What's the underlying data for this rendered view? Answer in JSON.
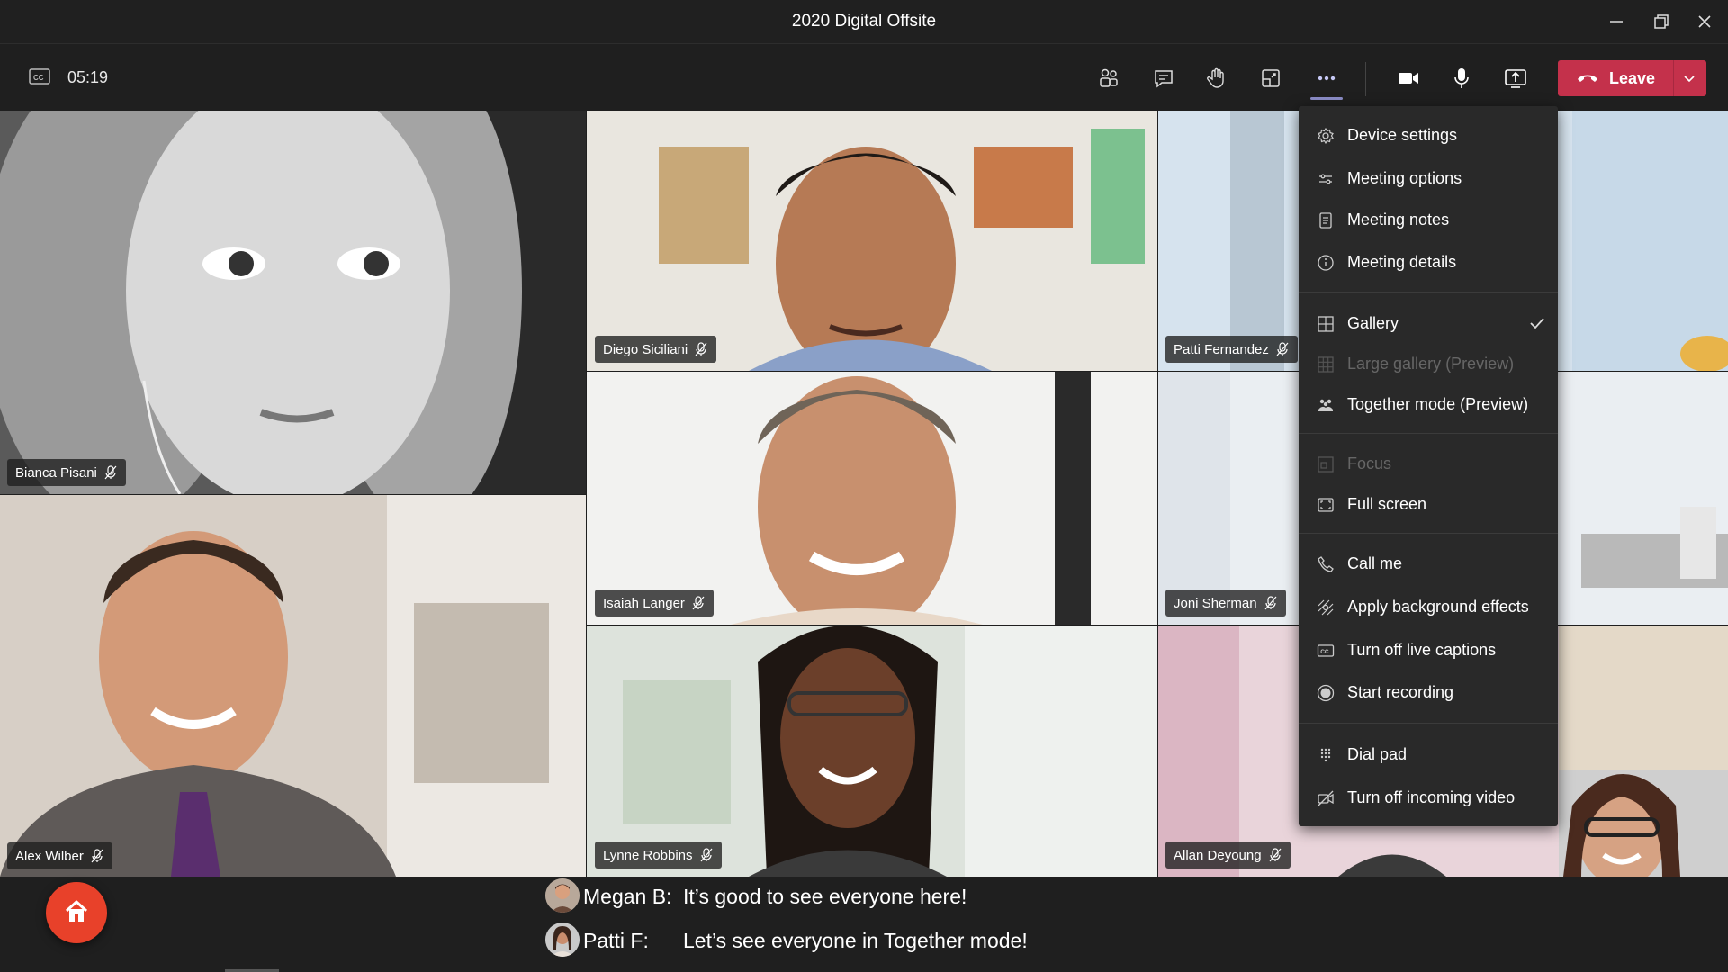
{
  "window": {
    "title": "2020 Digital Offsite"
  },
  "toolbar": {
    "timer": "05:19",
    "leave_label": "Leave",
    "icons": [
      "captions-icon",
      "people-icon",
      "chat-icon",
      "raise-hand-icon",
      "breakout-rooms-icon",
      "more-actions-icon",
      "camera-icon",
      "microphone-icon",
      "share-screen-icon",
      "hang-up-icon",
      "chevron-down-icon"
    ]
  },
  "participants": [
    {
      "name": "Bianca Pisani"
    },
    {
      "name": "Diego Siciliani"
    },
    {
      "name": "Patti Fernandez"
    },
    {
      "name": "Isaiah Langer"
    },
    {
      "name": "Joni Sherman"
    },
    {
      "name": "Alex Wilber"
    },
    {
      "name": "Lynne Robbins"
    },
    {
      "name": "Allan Deyoung"
    }
  ],
  "menu": {
    "items": [
      {
        "label": "Device settings",
        "icon": "gear-icon"
      },
      {
        "label": "Meeting options",
        "icon": "sliders-icon"
      },
      {
        "label": "Meeting notes",
        "icon": "notes-icon"
      },
      {
        "label": "Meeting details",
        "icon": "info-icon"
      },
      {
        "label": "Gallery",
        "icon": "grid-icon",
        "checked": true
      },
      {
        "label": "Large gallery (Preview)",
        "icon": "large-grid-icon",
        "disabled": true
      },
      {
        "label": "Together mode (Preview)",
        "icon": "together-mode-icon"
      },
      {
        "label": "Focus",
        "icon": "focus-icon",
        "disabled": true
      },
      {
        "label": "Full screen",
        "icon": "fullscreen-icon"
      },
      {
        "label": "Call me",
        "icon": "phone-icon"
      },
      {
        "label": "Apply background effects",
        "icon": "background-effects-icon"
      },
      {
        "label": "Turn off live captions",
        "icon": "captions-icon"
      },
      {
        "label": "Start recording",
        "icon": "record-icon"
      },
      {
        "label": "Dial pad",
        "icon": "dialpad-icon"
      },
      {
        "label": "Turn off incoming video",
        "icon": "video-off-icon"
      }
    ]
  },
  "captions": [
    {
      "speaker": "Megan B:",
      "text": "It’s good to see everyone here!"
    },
    {
      "speaker": "Patti F:",
      "text": "Let’s see everyone in Together mode!"
    }
  ],
  "colors": {
    "leave": "#c4314b",
    "accent": "#8b8cc7",
    "home": "#e8412a",
    "menu_bg": "#292929"
  }
}
